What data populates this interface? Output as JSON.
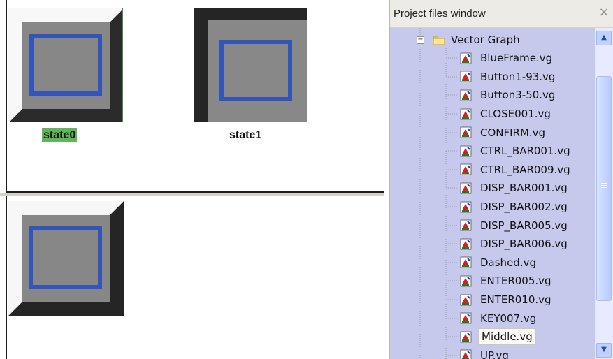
{
  "states": [
    {
      "label": "state0",
      "selected": true
    },
    {
      "label": "state1",
      "selected": false
    }
  ],
  "projectWindow": {
    "title": "Project files window",
    "close_icon": "close-icon",
    "folder": {
      "label": "Vector Graph",
      "expanded": true,
      "files": [
        "BlueFrame.vg",
        "Button1-93.vg",
        "Button3-50.vg",
        "CLOSE001.vg",
        "CONFIRM.vg",
        "CTRL_BAR001.vg",
        "CTRL_BAR009.vg",
        "DISP_BAR001.vg",
        "DISP_BAR002.vg",
        "DISP_BAR005.vg",
        "DISP_BAR006.vg",
        "Dashed.vg",
        "ENTER005.vg",
        "ENTER010.vg",
        "KEY007.vg",
        "Middle.vg",
        "UP.vg"
      ],
      "selected_file": "Middle.vg"
    },
    "scrollbar": {
      "up_icon": "up-arrow-icon",
      "down_icon": "down-arrow-icon"
    }
  },
  "colors": {
    "selectionGreen": "#62b45c",
    "treeBackground": "#c7c9ec",
    "frameBlue": "#3455b8",
    "frameGray": "#878787",
    "bevelLight": "#f7f7f7",
    "bevelDark": "#272727"
  }
}
